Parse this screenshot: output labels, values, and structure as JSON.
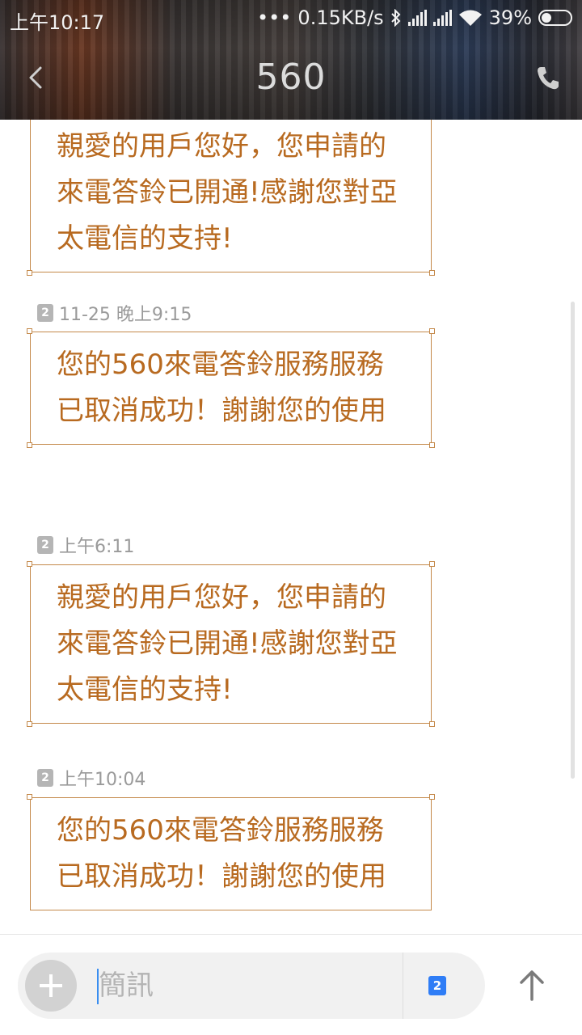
{
  "status_bar": {
    "time": "上午10:17",
    "network_speed": "0.15KB/s",
    "battery_percent": "39%",
    "icons": [
      "dots-icon",
      "bluetooth-icon",
      "signal-icon",
      "signal-icon",
      "wifi-icon",
      "battery-icon"
    ]
  },
  "header": {
    "title": "560",
    "back_icon": "chevron-left-icon",
    "call_icon": "phone-icon"
  },
  "messages": [
    {
      "time": "",
      "sim": "",
      "text": "親愛的用戶您好，您申請的來電答鈴已開通!感謝您對亞太電信的支持!"
    },
    {
      "time": "11-25 晚上9:15",
      "sim": "2",
      "text": "您的560來電答鈴服務服務已取消成功！謝謝您的使用"
    },
    {
      "time": "上午6:11",
      "sim": "2",
      "text": "親愛的用戶您好，您申請的來電答鈴已開通!感謝您對亞太電信的支持!"
    },
    {
      "time": "上午10:04",
      "sim": "2",
      "text": "您的560來電答鈴服務服務已取消成功！謝謝您的使用"
    }
  ],
  "composer": {
    "placeholder": "簡訊",
    "value": "",
    "sim_selected": "2",
    "add_icon": "plus-icon",
    "send_icon": "arrow-up-icon"
  },
  "colors": {
    "bubble_border": "#c4894a",
    "bubble_text": "#b86a20",
    "sim_badge_active": "#2f7df6",
    "sim_badge_inactive": "#b5b5b5"
  }
}
